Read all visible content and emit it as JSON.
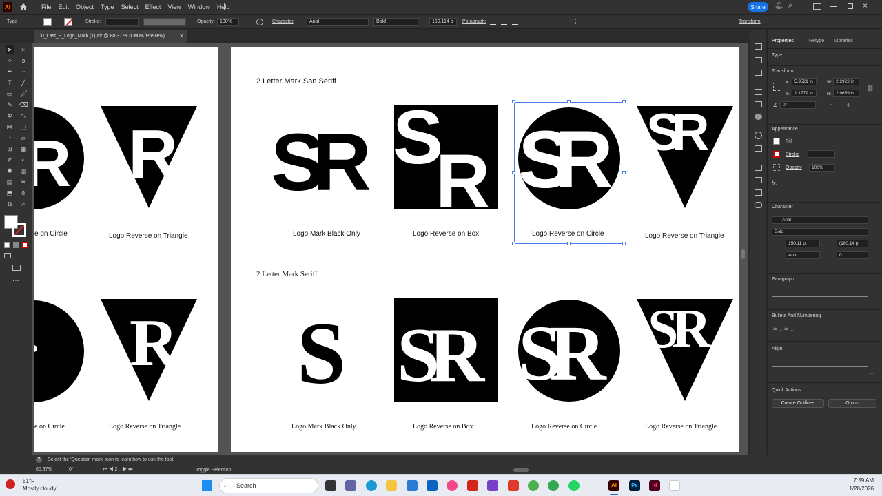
{
  "app": {
    "logo": "Ai",
    "home_icon": "home-icon"
  },
  "menu": [
    "File",
    "Edit",
    "Object",
    "Type",
    "Select",
    "Effect",
    "View",
    "Window",
    "Help"
  ],
  "share_label": "Share",
  "control": {
    "type_label": "Type",
    "stroke_label": "Stroke:",
    "opacity_label": "Opacity:",
    "opacity_value": "100%",
    "character_label": "Character",
    "font_value": "Arial",
    "style_value": "Bold",
    "size_value": "150.114 p",
    "paragraph_label": "Paragraph:",
    "transform_label": "Transform"
  },
  "document_tab": {
    "title": "00_Last_F_Logo_Mark (1).ai* @ 80.37 % (CMYK/Preview)",
    "close": "×"
  },
  "artboard_left": {
    "row1_circle_label": "e on Circle",
    "row1_triangle_label": "Logo Reverse on Triangle",
    "row2_circle_label": "e on Circle",
    "row2_triangle_label": "Logo Reverse on Triangle"
  },
  "artboard_main": {
    "section1_title": "2 Letter Mark San Seriff",
    "section2_title": "2 Letter Mark Seriff",
    "logo_text": "SR",
    "logo_s": "S",
    "logo_r": "R",
    "row1_labels": [
      "Logo Mark Black Only",
      "Logo Reverse on Box",
      "Logo Reverse on Circle",
      "Logo Reverse on Triangle"
    ],
    "row2_labels": [
      "Logo Mark Black Only",
      "Logo Reverse on Box",
      "Logo Reverse on Circle",
      "Logo Reverse on Triangle"
    ]
  },
  "panel": {
    "tabs": [
      "Properties",
      "Retype",
      "Libraries"
    ],
    "type_header": "Type",
    "transform_header": "Transform",
    "x_label": "X:",
    "x_value": "5.9521 in",
    "y_label": "Y:",
    "y_value": "1.1779 in",
    "w_label": "W:",
    "w_value": "2.2922 in",
    "h_label": "H:",
    "h_value": "2.9659 in",
    "angle_value": "0°",
    "appearance_header": "Appearance",
    "fill_label": "Fill",
    "stroke_label": "Stroke",
    "opacity_label": "Opacity",
    "opacity_value": "100%",
    "fx_label": "fx.",
    "character_header": "Character",
    "font_value": "Arial",
    "style_value": "Bold",
    "size_value": "150.11 pt",
    "leading_value": "(180.14 p",
    "tracking_value": "Auto",
    "kerning_value": "0",
    "paragraph_header": "Paragraph",
    "bullets_header": "Bullets And Numbering",
    "align_header": "Align",
    "quick_actions_header": "Quick Actions",
    "create_outlines": "Create Outlines",
    "group": "Group"
  },
  "status": {
    "hint": "Select the 'Question mark' icon to learn how to use the tool.",
    "zoom": "80.37%",
    "rotation": "0°",
    "artboard_num": "2",
    "mode": "Toggle Selection"
  },
  "taskbar": {
    "weather_temp": "51°F",
    "weather_desc": "Mostly cloudy",
    "search_placeholder": "Search",
    "time": "7:59 AM",
    "date": "1/28/2026"
  }
}
